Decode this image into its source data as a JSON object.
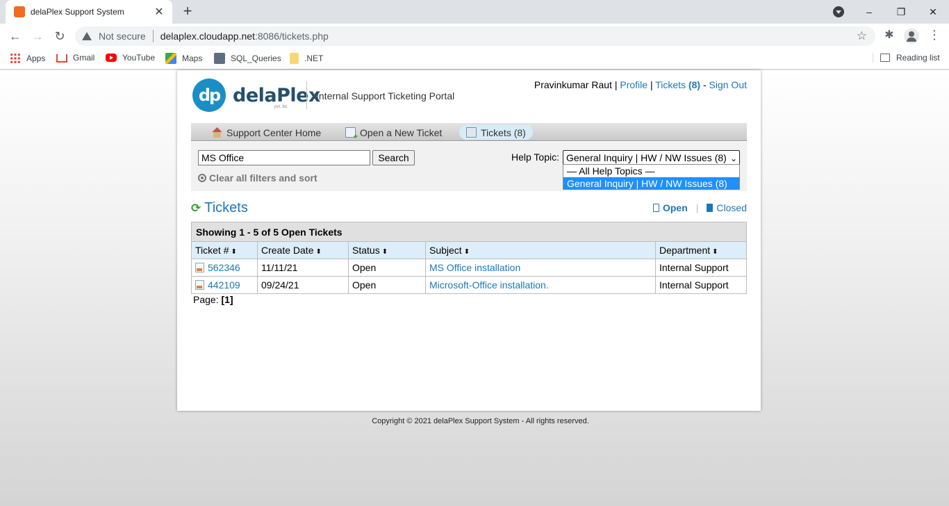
{
  "browser": {
    "tab_title": "delaPlex Support System",
    "tab_close": "✕",
    "new_tab": "+",
    "not_secure": "Not secure",
    "url_host": "delaplex.cloudapp.net",
    "url_path": ":8086/tickets.php",
    "bookmarks": [
      "Apps",
      "Gmail",
      "YouTube",
      "Maps",
      "SQL_Queries",
      ".NET"
    ],
    "reading_list": "Reading list",
    "window_controls": [
      "–",
      "❐",
      "✕"
    ]
  },
  "header": {
    "logo_mark": "dp",
    "logo_word": "delaPlex",
    "logo_sub": "pvt. ltd.",
    "portal_title": "Internal Support Ticketing Portal",
    "user_name": "Pravinkumar Raut",
    "sep": "|",
    "profile_link": "Profile",
    "tickets_link": "Tickets",
    "tickets_count": "(8)",
    "dash": "-",
    "signout_link": "Sign Out"
  },
  "nav": {
    "items": [
      "Support Center Home",
      "Open a New Ticket",
      "Tickets (8)"
    ],
    "active_index": 2
  },
  "filters": {
    "search_value": "MS Office",
    "search_button": "Search",
    "clear_label": "Clear all filters and sort",
    "help_topic_label": "Help Topic:",
    "help_topic_selected": "General Inquiry | HW / NW Issues (8)",
    "help_topic_options": [
      "— All Help Topics —",
      "General Inquiry | HW / NW Issues (8)"
    ],
    "highlighted_option_index": 1
  },
  "tickets": {
    "heading": "Tickets",
    "open_link": "Open",
    "closed_link": "Closed",
    "link_sep": "|",
    "caption": "Showing 1 - 5 of 5 Open Tickets",
    "columns": [
      "Ticket #",
      "Create Date",
      "Status",
      "Subject",
      "Department"
    ],
    "rows": [
      {
        "number": "562346",
        "date": "11/11/21",
        "status": "Open",
        "subject": "MS Office installation",
        "department": "Internal Support"
      },
      {
        "number": "442109",
        "date": "09/24/21",
        "status": "Open",
        "subject": "Microsoft-Office installation.",
        "department": "Internal Support"
      }
    ],
    "page_label": "Page:",
    "page_current": "[1]"
  },
  "footer": {
    "copyright": "Copyright © 2021 delaPlex Support System - All rights reserved."
  },
  "colors": {
    "link": "#1b78b8",
    "brand": "#1b8fc5",
    "selection": "#1e90ff"
  }
}
